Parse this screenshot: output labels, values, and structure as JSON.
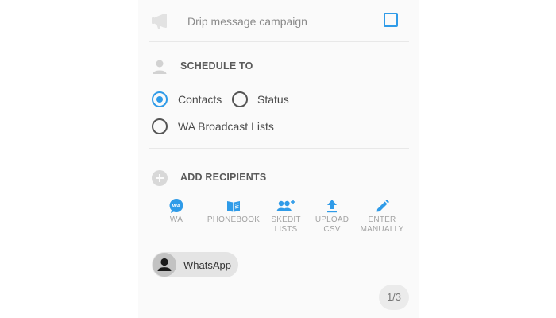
{
  "drip": {
    "label": "Drip message campaign",
    "checked": false
  },
  "schedule": {
    "title": "SCHEDULE TO",
    "options": [
      {
        "label": "Contacts",
        "selected": true
      },
      {
        "label": "Status",
        "selected": false
      },
      {
        "label": "WA Broadcast Lists",
        "selected": false
      }
    ]
  },
  "recipients": {
    "title": "ADD RECIPIENTS",
    "sources": [
      {
        "icon": "whatsapp-icon",
        "line1": "WA",
        "line2": ""
      },
      {
        "icon": "phonebook-icon",
        "line1": "PHONEBOOK",
        "line2": ""
      },
      {
        "icon": "skedit-lists-icon",
        "line1": "SKEDIT",
        "line2": "LISTS"
      },
      {
        "icon": "upload-icon",
        "line1": "UPLOAD",
        "line2": "CSV"
      },
      {
        "icon": "pencil-icon",
        "line1": "ENTER",
        "line2": "MANUALLY"
      }
    ],
    "wa_badge": "WA"
  },
  "selected_recipients": [
    {
      "name": "WhatsApp",
      "icon": "person-icon"
    }
  ],
  "pager": {
    "text": "1/3"
  },
  "colors": {
    "accent": "#2f9be8",
    "panel": "#fafafa",
    "muted": "#a3a3a3"
  }
}
